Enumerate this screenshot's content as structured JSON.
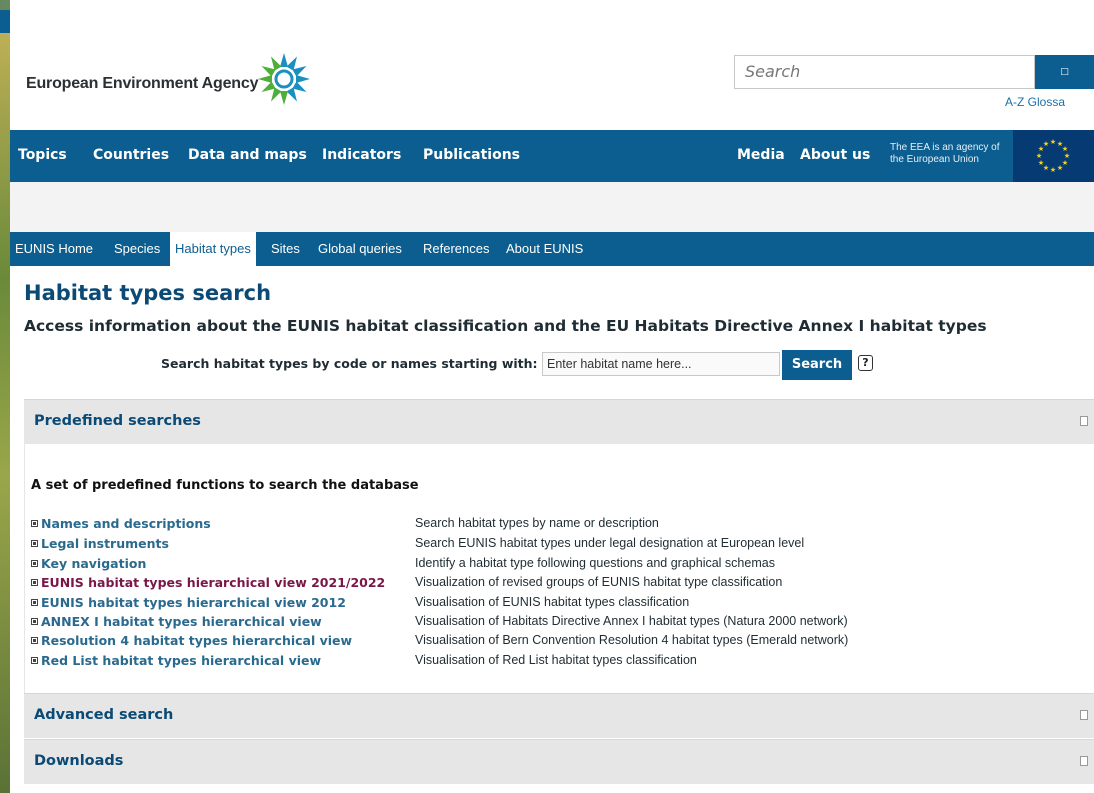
{
  "header": {
    "brand": "European Environment Agency",
    "search_placeholder": "Search",
    "search_button_icon": "□",
    "az_glossary": "A-Z Glossa"
  },
  "main_nav": {
    "items": [
      "Topics",
      "Countries",
      "Data and maps",
      "Indicators",
      "Publications"
    ],
    "right_items": [
      "Media",
      "About us"
    ],
    "eu_text_line1": "The EEA is an agency of",
    "eu_text_line2": "the European Union"
  },
  "eunis_nav": {
    "tabs": [
      "EUNIS Home",
      "Species",
      "Habitat types",
      "Sites",
      "Global queries",
      "References",
      "About EUNIS"
    ],
    "active_index": 2
  },
  "page": {
    "title": "Habitat types search",
    "subtitle": "Access information about the EUNIS habitat classification and the EU Habitats Directive Annex I habitat types",
    "quick_search_label": "Search habitat types by code or names starting with:",
    "quick_search_placeholder": "Enter habitat name here...",
    "quick_search_button": "Search",
    "help_icon": "?"
  },
  "panels": {
    "predefined": {
      "title": "Predefined searches",
      "toggle": "□",
      "body_title": "A set of predefined functions to search the database",
      "rows": [
        {
          "link": "Names and descriptions",
          "desc": "Search habitat types by name or description",
          "visited": false
        },
        {
          "link": "Legal instruments",
          "desc": "Search EUNIS habitat types under legal designation at European level",
          "visited": false
        },
        {
          "link": "Key navigation",
          "desc": "Identify a habitat type following questions and graphical schemas",
          "visited": false
        },
        {
          "link": "EUNIS habitat types hierarchical view 2021/2022",
          "desc": "Visualization of revised groups of EUNIS habitat type classification",
          "visited": true
        },
        {
          "link": "EUNIS habitat types hierarchical view 2012",
          "desc": "Visualisation of EUNIS habitat types classification",
          "visited": false
        },
        {
          "link": "ANNEX I habitat types hierarchical view",
          "desc": "Visualisation of Habitats Directive Annex I habitat types (Natura 2000 network)",
          "visited": false
        },
        {
          "link": "Resolution 4 habitat types hierarchical view",
          "desc": "Visualisation of Bern Convention Resolution 4 habitat types (Emerald network)",
          "visited": false
        },
        {
          "link": "Red List habitat types hierarchical view",
          "desc": "Visualisation of Red List habitat types classification",
          "visited": false
        }
      ]
    },
    "advanced": {
      "title": "Advanced search",
      "toggle": "□"
    },
    "downloads": {
      "title": "Downloads",
      "toggle": "□"
    }
  },
  "colors": {
    "brand_blue": "#0b5e8f",
    "title_blue": "#0a4a75",
    "link_blue": "#2a6a8e",
    "visited_link": "#7a1747",
    "panel_gray": "#e6e6e6"
  },
  "icons": {
    "logo": "eea-logo-icon",
    "flag": "eu-flag-icon"
  }
}
